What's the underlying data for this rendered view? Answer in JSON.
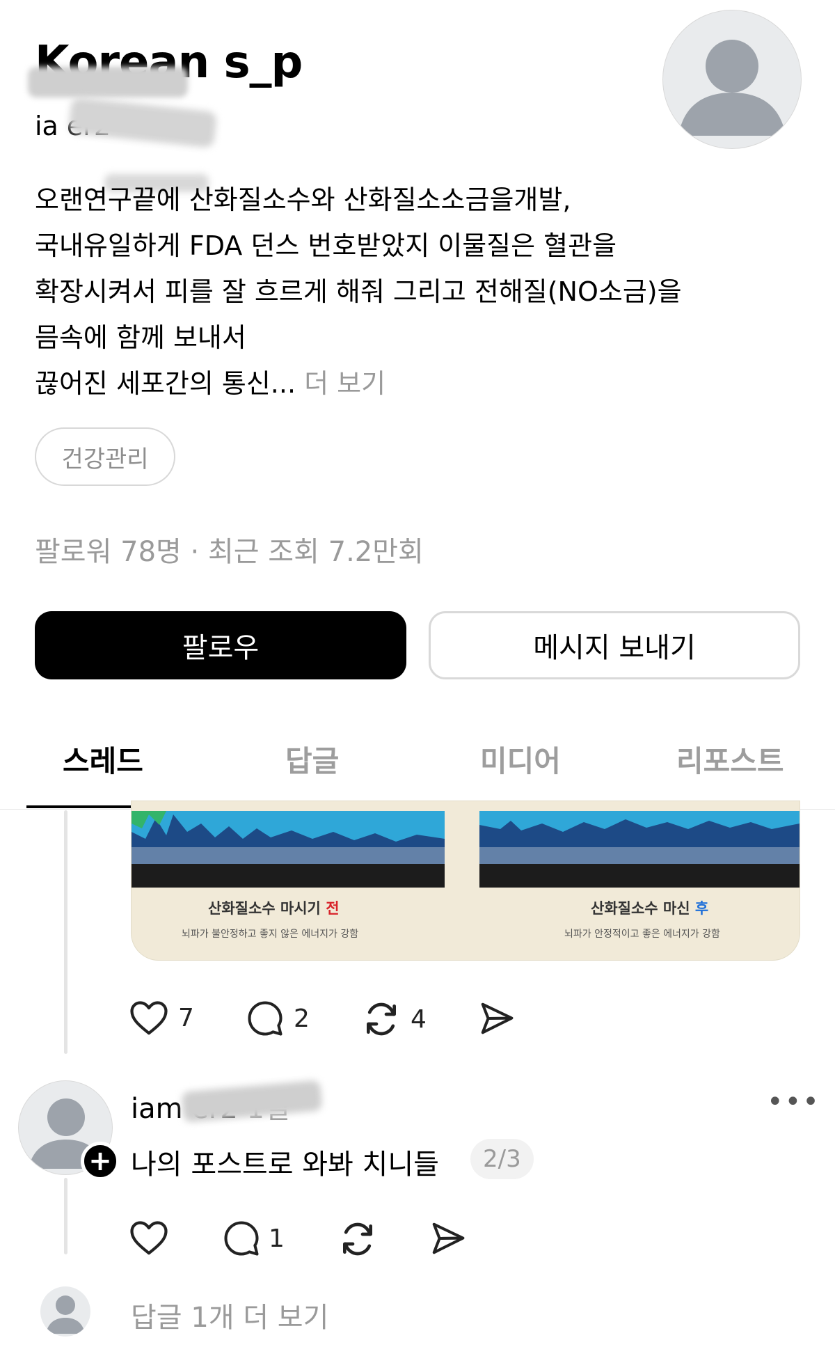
{
  "profile": {
    "name": "Korean s_p",
    "handle": "ia er2",
    "bio_lines": [
      "오랜연구끝에 산화질소수와 산화질소소금을개발,",
      "국내유일하게 FDA 던스 번호받았지 이물질은 혈관을",
      "확장시켜서 피를 잘 흐르게 해줘 그리고 전해질(NO소금)을",
      "믐속에 함께 보내서",
      "끊어진 세포간의 통신..."
    ],
    "bio_more": "더 보기",
    "tag": "건강관리",
    "followers": "팔로워 78명",
    "separator": "·",
    "views": "최근 조회 7.2만회",
    "follow_button": "팔로우",
    "message_button": "메시지 보내기"
  },
  "tabs": [
    {
      "label": "스레드",
      "active": true
    },
    {
      "label": "답글",
      "active": false
    },
    {
      "label": "미디어",
      "active": false
    },
    {
      "label": "리포스트",
      "active": false
    }
  ],
  "post": {
    "image": {
      "left_caption": "산화질소수 마시기",
      "left_caption_mark": "전",
      "left_sub": "뇌파가 불안정하고 좋지 않은 에너지가 강함",
      "right_caption": "산화질소수 마신",
      "right_caption_mark": "후",
      "right_sub": "뇌파가 안정적이고 좋은 에너지가 강함"
    },
    "likes": "7",
    "comments": "2",
    "reposts": "4"
  },
  "reply": {
    "username": "iam er2",
    "time": "1일",
    "text": "나의 포스트로 와봐 치니들",
    "pager": "2/3",
    "likes": "",
    "comments": "1",
    "reposts": ""
  },
  "more_replies": "답글 1개 더 보기",
  "colors": {
    "caption_before": "#d8232a",
    "caption_after": "#1e6fd9",
    "secondary_text": "#9a9a9a"
  },
  "icons": [
    "heart-icon",
    "comment-icon",
    "repost-icon",
    "share-icon",
    "more-icon",
    "avatar-placeholder-icon",
    "plus-icon"
  ]
}
